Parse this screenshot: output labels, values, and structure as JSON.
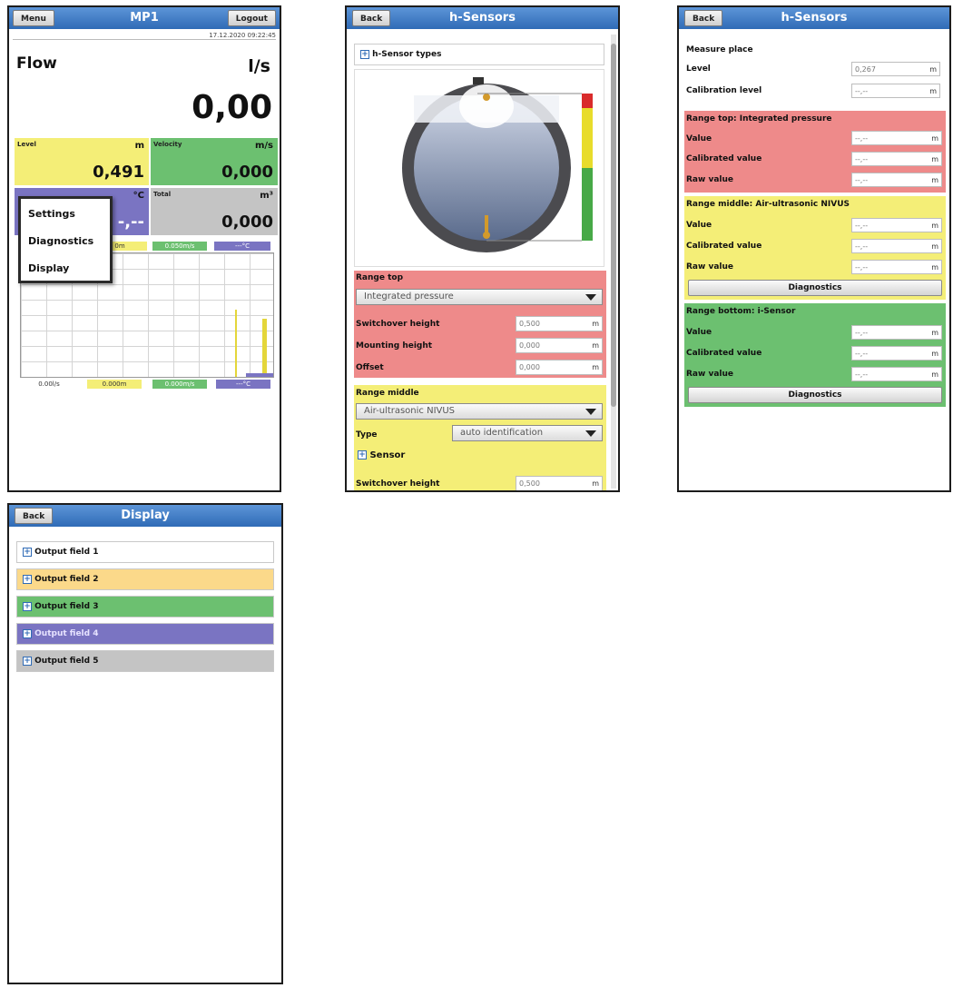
{
  "screen1": {
    "menu_label": "Menu",
    "title": "MP1",
    "logout_label": "Logout",
    "timestamp": "17.12.2020 09:22:45",
    "flow_label": "Flow",
    "flow_unit": "l/s",
    "flow_value": "0,00",
    "level_label": "Level",
    "level_unit": "m",
    "level_value": "0,491",
    "velocity_label": "Velocity",
    "velocity_unit": "m/s",
    "velocity_value": "0,000",
    "temp_unit": "°C",
    "temp_value": "-,--",
    "total_label": "Total",
    "total_unit": "m³",
    "total_value": "0,000",
    "menu_items": [
      "Settings",
      "Diagnostics",
      "Display"
    ],
    "chart_top_chips": [
      "0m",
      "0.050m/s",
      "---°C"
    ],
    "chart_bottom_chips": [
      "0.00l/s",
      "0.000m",
      "0.000m/s",
      "---°C"
    ]
  },
  "screen2": {
    "back_label": "Back",
    "title": "h-Sensors",
    "sensor_types_label": "h-Sensor types",
    "range_top": {
      "header": "Range top",
      "select_value": "Integrated pressure",
      "rows": [
        {
          "label": "Switchover height",
          "value": "0,500",
          "unit": "m"
        },
        {
          "label": "Mounting height",
          "value": "0,000",
          "unit": "m"
        },
        {
          "label": "Offset",
          "value": "0,000",
          "unit": "m"
        }
      ]
    },
    "range_middle": {
      "header": "Range middle",
      "select_value": "Air-ultrasonic NIVUS",
      "type_label": "Type",
      "type_value": "auto identification",
      "sensor_label": "Sensor",
      "switchover_label": "Switchover height",
      "switchover_value": "0,500",
      "unit": "m"
    }
  },
  "screen3": {
    "back_label": "Back",
    "title": "h-Sensors",
    "measure_place": "Measure place",
    "level_label": "Level",
    "level_value": "0,267",
    "calib_level_label": "Calibration level",
    "placeholder": "--,--",
    "unit": "m",
    "sections": [
      {
        "header": "Range top: Integrated pressure",
        "rows": [
          "Value",
          "Calibrated value",
          "Raw value"
        ],
        "button": ""
      },
      {
        "header": "Range middle: Air-ultrasonic NIVUS",
        "rows": [
          "Value",
          "Calibrated value",
          "Raw value"
        ],
        "button": "Diagnostics"
      },
      {
        "header": "Range bottom: i-Sensor",
        "rows": [
          "Value",
          "Calibrated value",
          "Raw value"
        ],
        "button": "Diagnostics"
      }
    ]
  },
  "screen4": {
    "back_label": "Back",
    "title": "Display",
    "fields": [
      "Output field 1",
      "Output field 2",
      "Output field 3",
      "Output field 4",
      "Output field 5"
    ]
  },
  "colors": {
    "red": "#ee8a8a",
    "yellow": "#f4ee77",
    "green": "#6cc070",
    "purple": "#7a74c2",
    "grey": "#c4c4c4",
    "orange_light": "#fbd98a",
    "title_blue": "#2f6bb6"
  }
}
